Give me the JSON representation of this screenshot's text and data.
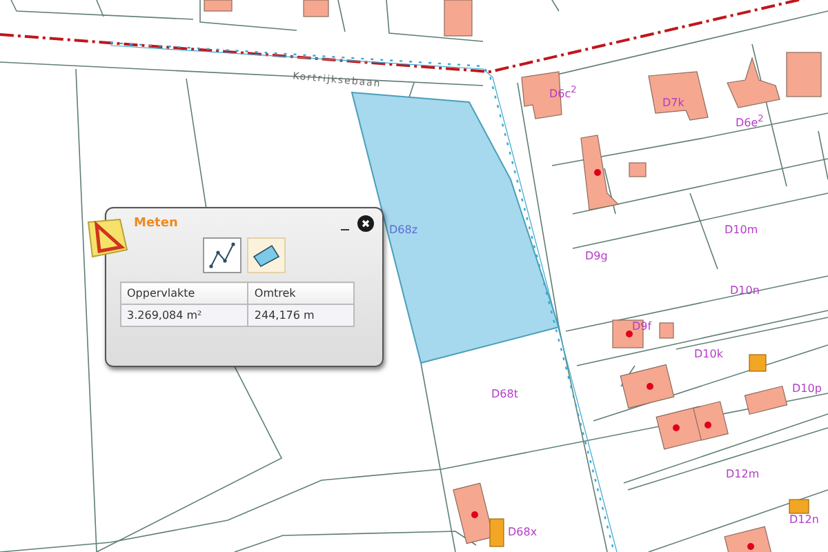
{
  "map": {
    "street_label": "Kortrijksebaan",
    "parcel_labels": [
      {
        "text": "D68z",
        "selected": true
      },
      {
        "text": "D68t",
        "selected": false
      },
      {
        "text": "D9g",
        "selected": false
      },
      {
        "text": "D10m",
        "selected": false
      },
      {
        "text": "D10n",
        "selected": false
      },
      {
        "text": "D9f",
        "selected": false
      },
      {
        "text": "D10k",
        "selected": false
      },
      {
        "text": "D10p",
        "selected": false
      },
      {
        "text": "D12m",
        "selected": false
      },
      {
        "text": "D12n",
        "selected": false
      },
      {
        "text": "D68x",
        "selected": false
      },
      {
        "text": "D6c$^{2}$",
        "selected": false
      },
      {
        "text": "D7k",
        "selected": false
      },
      {
        "text": "D6e$^{2}$",
        "selected": false
      }
    ]
  },
  "dialog": {
    "title": "Meten",
    "tools": [
      {
        "kind": "line",
        "selected": false
      },
      {
        "kind": "area",
        "selected": true
      }
    ],
    "table": {
      "columns": [
        "Oppervlakte",
        "Omtrek"
      ],
      "rows": [
        [
          "3.269,084 m²",
          "244,176 m"
        ]
      ]
    }
  }
}
